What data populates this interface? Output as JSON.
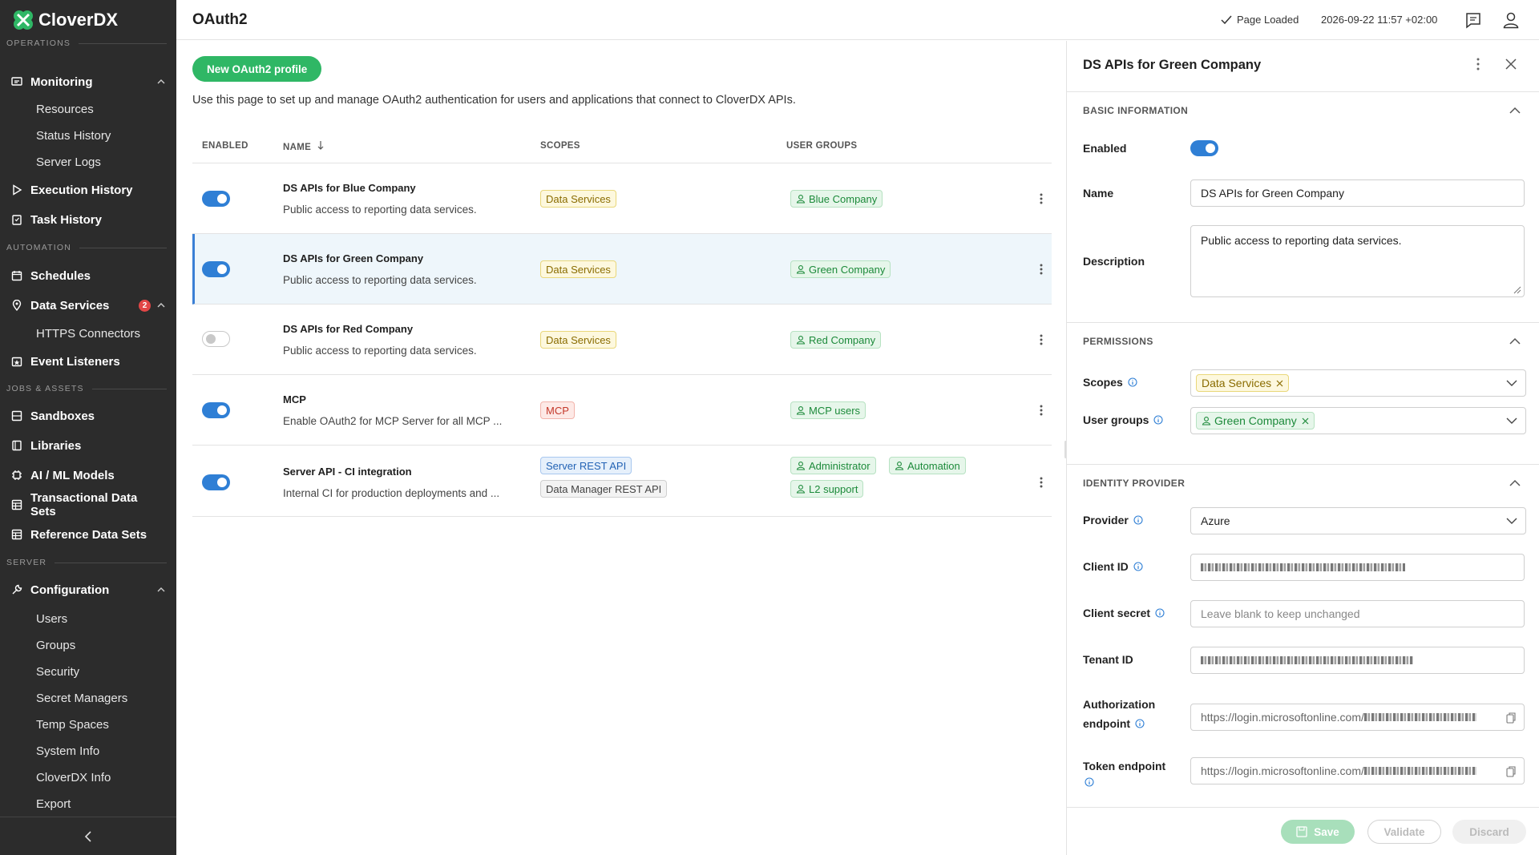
{
  "app": {
    "name": "CloverDX"
  },
  "sidebar": {
    "sections": {
      "operations": "OPERATIONS",
      "automation": "AUTOMATION",
      "jobs_assets": "JOBS & ASSETS",
      "server": "SERVER"
    },
    "monitoring": {
      "label": "Monitoring",
      "items": [
        "Resources",
        "Status History",
        "Server Logs"
      ]
    },
    "execution_history": "Execution History",
    "task_history": "Task History",
    "schedules": "Schedules",
    "data_services": {
      "label": "Data Services",
      "badge": "2",
      "items": [
        "HTTPS Connectors"
      ]
    },
    "event_listeners": "Event Listeners",
    "sandboxes": "Sandboxes",
    "libraries": "Libraries",
    "ai_ml_models": "AI / ML Models",
    "transactional_data_sets": "Transactional Data Sets",
    "reference_data_sets": "Reference Data Sets",
    "configuration": {
      "label": "Configuration",
      "items": [
        "Users",
        "Groups",
        "Security",
        "Secret Managers",
        "Temp Spaces",
        "System Info",
        "CloverDX Info",
        "Export"
      ]
    }
  },
  "header": {
    "title": "OAuth2",
    "status": "Page Loaded",
    "timestamp": "2026-09-22 11:57 +02:00"
  },
  "main": {
    "new_button": "New OAuth2 profile",
    "intro": "Use this page to set up and manage OAuth2 authentication for users and applications that connect to CloverDX APIs.",
    "columns": {
      "enabled": "ENABLED",
      "name": "NAME",
      "scopes": "SCOPES",
      "user_groups": "USER GROUPS"
    },
    "rows": [
      {
        "enabled": true,
        "name": "DS APIs for Blue Company",
        "description": "Public access to reporting data services.",
        "scopes": [
          "Data Services"
        ],
        "groups": [
          "Blue Company"
        ]
      },
      {
        "enabled": true,
        "name": "DS APIs for Green Company",
        "description": "Public access to reporting data services.",
        "scopes": [
          "Data Services"
        ],
        "groups": [
          "Green Company"
        ]
      },
      {
        "enabled": false,
        "name": "DS APIs for Red Company",
        "description": "Public access to reporting data services.",
        "scopes": [
          "Data Services"
        ],
        "groups": [
          "Red Company"
        ]
      },
      {
        "enabled": true,
        "name": "MCP",
        "description": "Enable OAuth2 for MCP Server for all MCP ...",
        "scopes": [
          "MCP"
        ],
        "groups": [
          "MCP users"
        ]
      },
      {
        "enabled": true,
        "name": "Server API - CI integration",
        "description": "Internal CI for production deployments and ...",
        "scopes": [
          "Server REST API",
          "Data Manager REST API"
        ],
        "groups": [
          "Administrator",
          "Automation",
          "L2 support"
        ]
      }
    ]
  },
  "panel": {
    "title": "DS APIs for Green Company",
    "basic": {
      "section": "BASIC INFORMATION",
      "enabled_label": "Enabled",
      "name_label": "Name",
      "name_value": "DS APIs for Green Company",
      "description_label": "Description",
      "description_value": "Public access to reporting data services."
    },
    "permissions": {
      "section": "PERMISSIONS",
      "scopes_label": "Scopes",
      "scopes_value": "Data Services",
      "groups_label": "User groups",
      "groups_value": "Green Company"
    },
    "identity": {
      "section": "IDENTITY PROVIDER",
      "provider_label": "Provider",
      "provider_value": "Azure",
      "client_id_label": "Client ID",
      "client_secret_label": "Client secret",
      "client_secret_placeholder": "Leave blank to keep unchanged",
      "tenant_id_label": "Tenant ID",
      "auth_endpoint_label_1": "Authorization",
      "auth_endpoint_label_2": "endpoint",
      "auth_endpoint_value": "https://login.microsoftonline.com/",
      "token_endpoint_label": "Token endpoint",
      "token_endpoint_value": "https://login.microsoftonline.com/"
    },
    "footer": {
      "save": "Save",
      "validate": "Validate",
      "discard": "Discard"
    }
  },
  "colors": {
    "accent": "#2fb765",
    "toggle": "#2f7fd5",
    "sidebar": "#2c2c2c"
  }
}
